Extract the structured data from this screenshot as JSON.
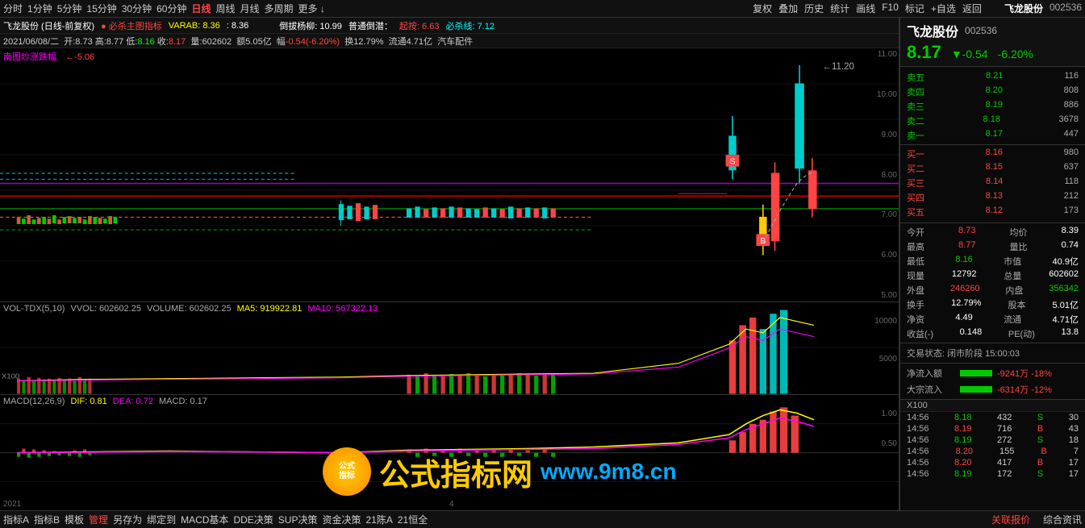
{
  "toolbar": {
    "timeframes": [
      "分时",
      "1分钟",
      "5分钟",
      "15分钟",
      "30分钟",
      "60分钟",
      "日线",
      "周线",
      "月线",
      "多周期",
      "更多 ↓"
    ],
    "right_tools": [
      "复权",
      "叠加",
      "历史",
      "统计",
      "画线",
      "F10",
      "标记",
      "+自选",
      "返回"
    ]
  },
  "chart_info": {
    "stock_name": "飞龙股份 (日线-前复权)",
    "indicator": "必杀主图指标",
    "varab": "VARAB: 8.36",
    "varab_val": "8.36",
    "label2": "倒拔杨柳: 10.99",
    "label3": "普通倒潜：",
    "rise_label": "起按:",
    "rise_val": "6.63",
    "must_line": "必杀线:",
    "must_val": "7.12"
  },
  "date_info": "2021/06/08/二  开:8.73 高:8.77 低:8.16 收:8.17  量:602602  额5.05亿  幅-0.54(-6.20%)  换12.79%  流通4.71亿  汽车配件",
  "price_levels": [
    "11.00",
    "10.00",
    "9.00",
    "8.00",
    "7.00",
    "6.00",
    "5.00"
  ],
  "vol_label": "VOL-TDX(5,10)  VVOL: 602602.25  VOLUME: 602602.25  MA5: 919922.81  MA10: 567322.13",
  "macd_label": "MACD(12,26,9)  DIF: 0.81  DEA: 0.72  MACD: 0.17",
  "x100_label": "X100",
  "y_labels_vol": [
    "10000",
    "5000"
  ],
  "y_labels_macd": [
    "1.00",
    "0.50"
  ],
  "year_label": "2021",
  "number_4": "4",
  "bottom_toolbar": [
    "指标A",
    "指标B",
    "模板",
    "管理",
    "另存为",
    "绑定到",
    "MACD基本",
    "DDE决策",
    "SUP决策",
    "资金决策",
    "21陈A",
    "21恒全"
  ],
  "bottom_tabs": [
    "关联报价",
    "综合资讯"
  ],
  "stock": {
    "name": "飞龙股份",
    "code": "002536",
    "price": "8.17",
    "change": "▼-0.54",
    "pct": "-6.20%",
    "sell5": {
      "label": "卖五",
      "price": "8.21",
      "vol": "116"
    },
    "sell4": {
      "label": "卖四",
      "price": "8.20",
      "vol": "808"
    },
    "sell3": {
      "label": "卖三",
      "price": "8.19",
      "vol": "886"
    },
    "sell2": {
      "label": "卖二",
      "price": "8.18",
      "vol": "3678"
    },
    "sell1": {
      "label": "卖一",
      "price": "8.17",
      "vol": "447"
    },
    "buy1": {
      "label": "买一",
      "price": "8.16",
      "vol": "980"
    },
    "buy2": {
      "label": "买二",
      "price": "8.15",
      "vol": "637"
    },
    "buy3": {
      "label": "买三",
      "price": "8.14",
      "vol": "118"
    },
    "buy4": {
      "label": "买四",
      "price": "8.13",
      "vol": "212"
    },
    "buy5": {
      "label": "买五",
      "price": "8.12",
      "vol": "173"
    },
    "today_open": "8.73",
    "avg_price": "8.39",
    "high": "8.77",
    "vol_ratio": "0.74",
    "low": "8.16",
    "market_cap": "40.9亿",
    "current_vol": "12792",
    "total_share": "602602",
    "outer_vol": "246260",
    "inner_vol": "356342",
    "turnover": "12.79%",
    "share_total": "5.01亿",
    "net_asset": "4.49",
    "float_share": "4.71亿",
    "earnings": "0.148",
    "pe": "13.8",
    "trade_status": "交易状态: 闭市阶段 15:00:03",
    "net_inflow_label": "净流入额",
    "net_inflow_val": "-9241万 -18%",
    "block_inflow_label": "大宗流入",
    "block_inflow_val": "-6314万 -12%",
    "x100": "X100"
  },
  "ticks": [
    {
      "time": "14:56",
      "price": "8.18",
      "vol": "432",
      "type": "S",
      "extra": "30"
    },
    {
      "time": "14:56",
      "price": "8.19",
      "vol": "716",
      "type": "B",
      "extra": "43"
    },
    {
      "time": "14:56",
      "price": "8.19",
      "vol": "272",
      "type": "S",
      "extra": "18"
    },
    {
      "time": "14:56",
      "price": "8.20",
      "vol": "155",
      "type": "B",
      "extra": "7"
    },
    {
      "time": "14:56",
      "price": "8.20",
      "vol": "417",
      "type": "B",
      "extra": "17"
    },
    {
      "time": "14:56",
      "price": "8.19",
      "vol": "172",
      "type": "S",
      "extra": "17"
    }
  ]
}
